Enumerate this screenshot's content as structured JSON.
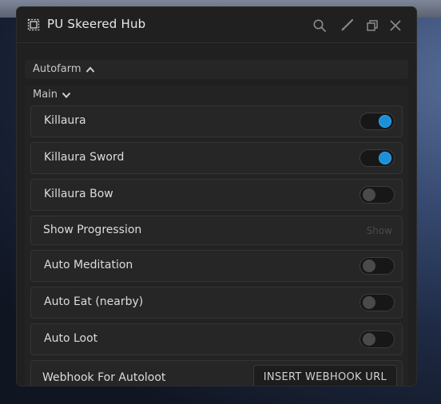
{
  "window": {
    "title": "PU Skeered Hub",
    "icons": [
      "frame-icon",
      "search-icon",
      "brush-icon",
      "restore-icon",
      "close-icon"
    ]
  },
  "sections": {
    "autofarm": {
      "label": "Autofarm",
      "state": "collapsed-arrow-up"
    },
    "main": {
      "label": "Main",
      "state": "expanded-arrow-down"
    }
  },
  "rows": [
    {
      "label": "Killaura",
      "type": "toggle",
      "value": true
    },
    {
      "label": "Killaura Sword",
      "type": "toggle",
      "value": true
    },
    {
      "label": "Killaura Bow",
      "type": "toggle",
      "value": false
    },
    {
      "label": "Show Progression",
      "type": "button",
      "action": "Show"
    },
    {
      "label": "Auto Meditation",
      "type": "toggle",
      "value": false
    },
    {
      "label": "Auto Eat (nearby)",
      "type": "toggle",
      "value": false
    },
    {
      "label": "Auto Loot",
      "type": "toggle",
      "value": false
    },
    {
      "label": "Webhook For Autoloot",
      "type": "input",
      "placeholder": "INSERT WEBHOOK URL"
    }
  ],
  "colors": {
    "accent": "#1e8fd6",
    "window_bg": "#202020",
    "row_bg": "#262626"
  }
}
